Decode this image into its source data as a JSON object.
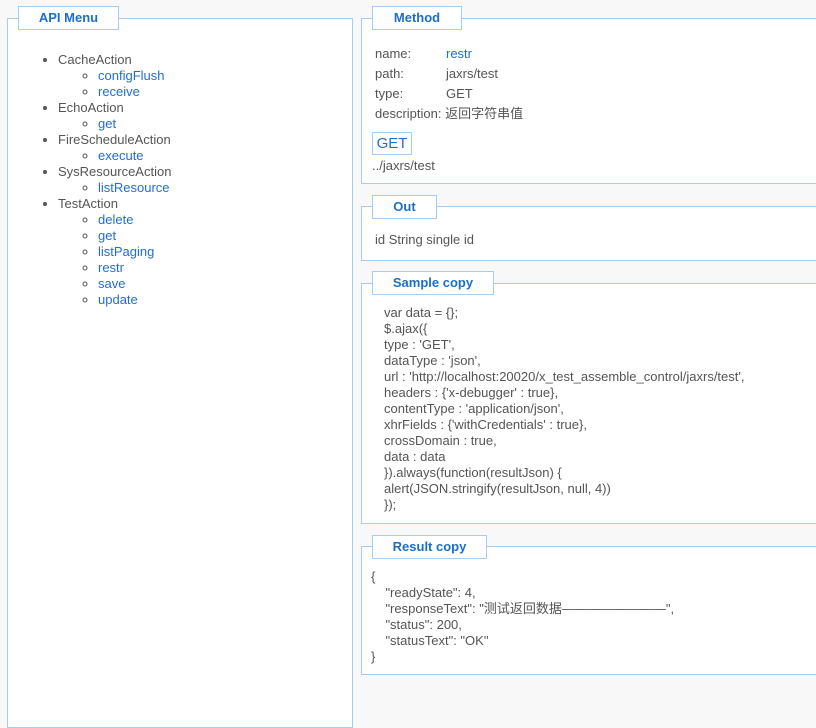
{
  "menu": {
    "title": "API Menu",
    "groups": [
      {
        "name": "CacheAction",
        "items": [
          "configFlush",
          "receive"
        ]
      },
      {
        "name": "EchoAction",
        "items": [
          "get"
        ]
      },
      {
        "name": "FireScheduleAction",
        "items": [
          "execute"
        ]
      },
      {
        "name": "SysResourceAction",
        "items": [
          "listResource"
        ]
      },
      {
        "name": "TestAction",
        "items": [
          "delete",
          "get",
          "listPaging",
          "restr",
          "save",
          "update"
        ]
      }
    ]
  },
  "method": {
    "title": "Method",
    "name_label": "name:",
    "name": "restr",
    "path_label": "path:",
    "path": "jaxrs/test",
    "type_label": "type:",
    "type": "GET",
    "description_label": "description:",
    "description": "返回字符串值",
    "button": "GET",
    "url": "../jaxrs/test"
  },
  "out": {
    "title": "Out",
    "text": "id String single id"
  },
  "sample": {
    "title": "Sample copy",
    "lines": [
      "var data = {};",
      "$.ajax({",
      "type : 'GET',",
      "dataType : 'json',",
      "url : 'http://localhost:20020/x_test_assemble_control/jaxrs/test',",
      "headers : {'x-debugger' : true},",
      "contentType : 'application/json',",
      "xhrFields : {'withCredentials' : true},",
      "crossDomain : true,",
      "data : data",
      "}).always(function(resultJson) {",
      "alert(JSON.stringify(resultJson, null, 4))",
      "});"
    ]
  },
  "result": {
    "title": "Result copy",
    "lines": [
      "{",
      "    \"readyState\": 4,",
      "    \"responseText\": \"测试返回数据————————\",",
      "    \"status\": 200,",
      "    \"statusText\": \"OK\"",
      "}"
    ]
  }
}
